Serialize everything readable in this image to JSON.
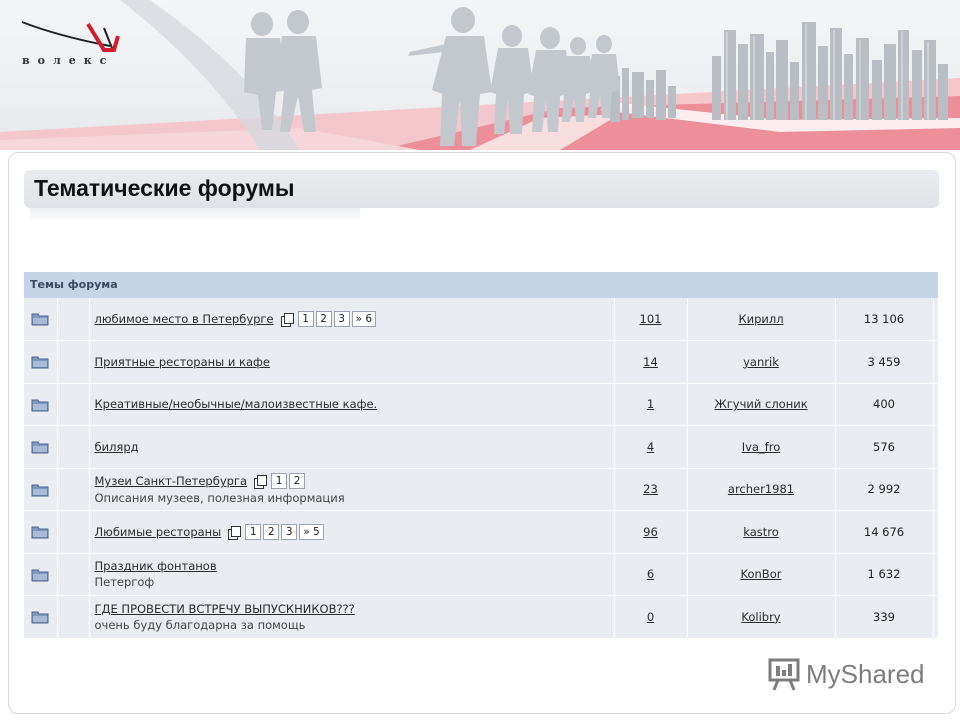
{
  "logo": {
    "text": "волекс"
  },
  "page_title": "Тематические форумы",
  "forum": {
    "header": "Темы форума",
    "rows": [
      {
        "title": "любимое место в Петербурге",
        "subtitle": "",
        "pages": [
          "1",
          "2",
          "3",
          "» 6"
        ],
        "replies": "101",
        "author": "Кирилл",
        "views": "13 106"
      },
      {
        "title": "Приятные рестораны и кафе",
        "subtitle": "",
        "pages": [],
        "replies": "14",
        "author": "yanrik",
        "views": "3 459"
      },
      {
        "title": "Креативные/необычные/малоизвестные кафе.",
        "subtitle": "",
        "pages": [],
        "replies": "1",
        "author": "Жгучий слоник",
        "views": "400"
      },
      {
        "title": "билярд",
        "subtitle": "",
        "pages": [],
        "replies": "4",
        "author": "Iva_fro",
        "views": "576"
      },
      {
        "title": "Музеи Санкт-Петербурга",
        "subtitle": "Описания музеев, полезная информация",
        "pages": [
          "1",
          "2"
        ],
        "replies": "23",
        "author": "archer1981",
        "views": "2 992"
      },
      {
        "title": "Любимые рестораны",
        "subtitle": "",
        "pages": [
          "1",
          "2",
          "3",
          "» 5"
        ],
        "replies": "96",
        "author": "kastro",
        "views": "14 676"
      },
      {
        "title": "Праздник фонтанов",
        "subtitle": "Петергоф",
        "pages": [],
        "replies": "6",
        "author": "KonBor",
        "views": "1 632"
      },
      {
        "title": "ГДЕ ПРОВЕСТИ ВСТРЕЧУ ВЫПУСКНИКОВ???",
        "subtitle": "очень буду благодарна за помощь",
        "pages": [],
        "replies": "0",
        "author": "Kolibry",
        "views": "339"
      }
    ]
  },
  "watermark": {
    "text": "MyShared",
    "icon": "presentation-board-icon"
  },
  "colors": {
    "header_bg": "#c5d4e8",
    "row_bg": "#e9ecf1",
    "accent_red": "#e8737e",
    "banner_bg": "#eceef0"
  }
}
